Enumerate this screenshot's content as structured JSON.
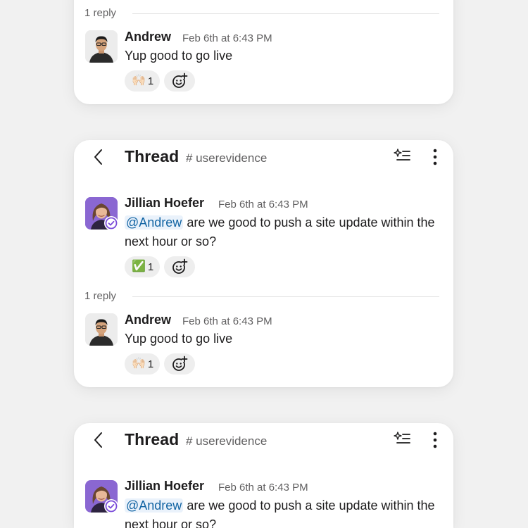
{
  "thread": {
    "title": "Thread",
    "channel": "# userevidence"
  },
  "parent": {
    "author": "Jillian Hoefer",
    "time": "Feb 6th at 6:43 PM",
    "mention": "@Andrew",
    "text": " are we good to push a site update within the next hour or so?",
    "reaction": {
      "emoji": "✅",
      "count": "1"
    }
  },
  "replies": {
    "count_label": "1 reply"
  },
  "reply": {
    "author": "Andrew",
    "time": "Feb 6th at 6:43 PM",
    "text": "Yup good to go live",
    "reaction": {
      "emoji": "🙌🏻",
      "count": "1"
    }
  },
  "colors": {
    "background": "#f1f1f1",
    "card": "#ffffff",
    "mention_bg": "#eaf2fb",
    "mention_text": "#1264a3",
    "badge": "#7a4bd9"
  },
  "icons": [
    "back-arrow-icon",
    "ai-summary-icon",
    "more-vertical-icon",
    "add-reaction-icon",
    "verified-badge-icon"
  ]
}
